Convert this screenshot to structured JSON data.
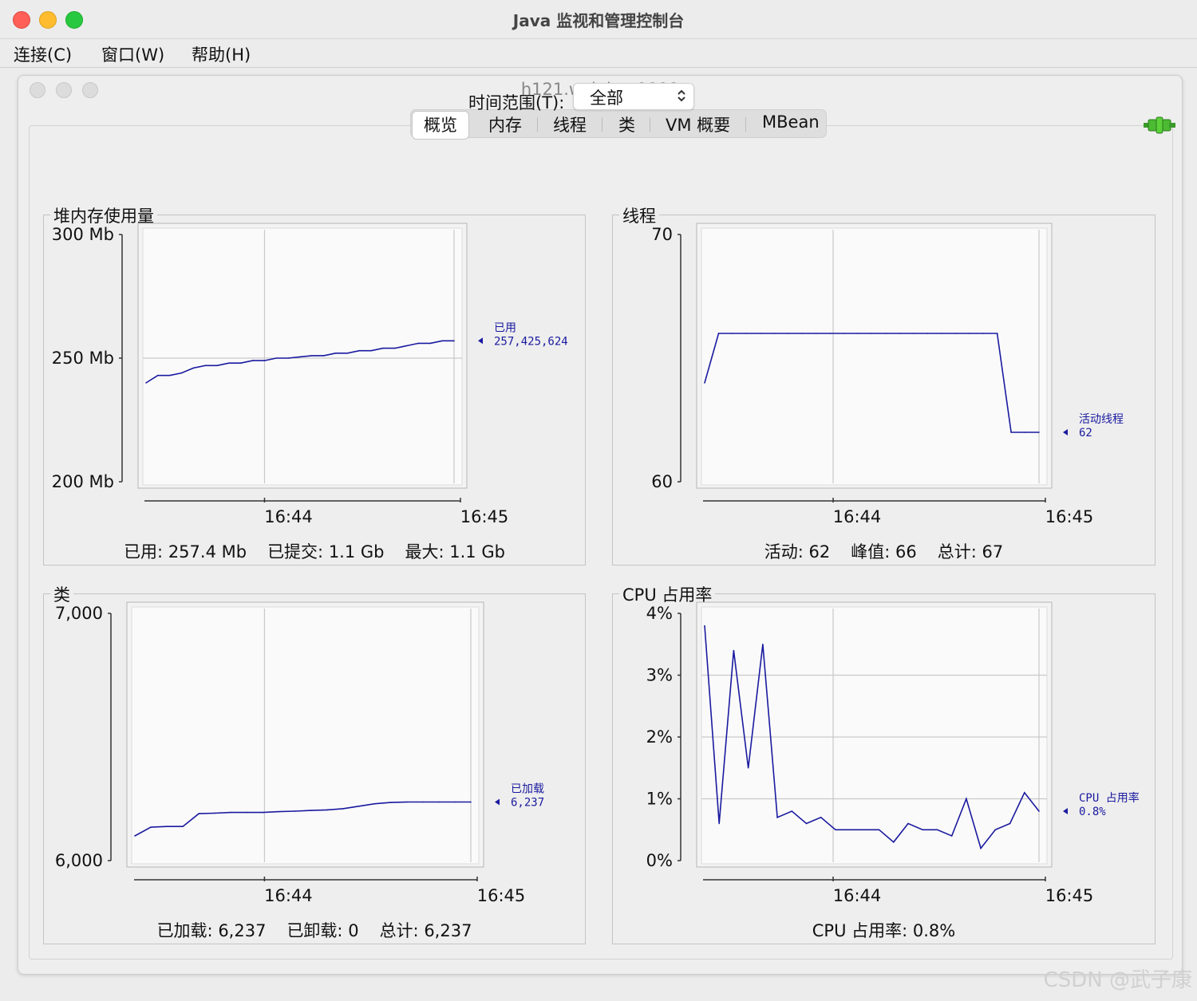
{
  "window": {
    "title": "Java 监视和管理控制台"
  },
  "menu": [
    "连接(C)",
    "窗口(W)",
    "帮助(H)"
  ],
  "connection": {
    "title": "h121.wzk.icu:9999"
  },
  "tabs": [
    {
      "label": "概览",
      "active": true
    },
    {
      "label": "内存"
    },
    {
      "label": "线程"
    },
    {
      "label": "类"
    },
    {
      "label": "VM 概要"
    },
    {
      "label": "MBean"
    }
  ],
  "time_range": {
    "label": "时间范围(T):",
    "value": "全部"
  },
  "x_ticks": [
    "16:44",
    "16:45"
  ],
  "colors": {
    "line": "#1a1aa0",
    "grid": "#c9c9c9"
  },
  "chart_data": [
    {
      "type": "line",
      "title": "堆内存使用量",
      "y_ticks": [
        "300 Mb",
        "250 Mb",
        "200 Mb"
      ],
      "ylim": [
        200,
        300
      ],
      "y": [
        240,
        243,
        243,
        244,
        246,
        247,
        247,
        248,
        248,
        249,
        249,
        250,
        250,
        250.5,
        251,
        251,
        252,
        252,
        253,
        253,
        254,
        254,
        255,
        256,
        256,
        257,
        257
      ],
      "legend": {
        "name": "已用",
        "value": "257,425,624"
      },
      "summary": [
        "已用: 257.4 Mb",
        "已提交: 1.1 Gb",
        "最大: 1.1 Gb"
      ]
    },
    {
      "type": "line",
      "title": "线程",
      "y_ticks": [
        "70",
        "60"
      ],
      "ylim": [
        60,
        70
      ],
      "y": [
        64,
        66,
        66,
        66,
        66,
        66,
        66,
        66,
        66,
        66,
        66,
        66,
        66,
        66,
        66,
        66,
        66,
        66,
        66,
        66,
        66,
        66,
        62,
        62,
        62
      ],
      "legend": {
        "name": "活动线程",
        "value": "62"
      },
      "summary": [
        "活动: 62",
        "峰值: 66",
        "总计: 67"
      ]
    },
    {
      "type": "line",
      "title": "类",
      "y_ticks": [
        "7,000",
        "6,000"
      ],
      "ylim": [
        6000,
        7000
      ],
      "y": [
        6100,
        6135,
        6138,
        6138,
        6190,
        6192,
        6195,
        6195,
        6195,
        6198,
        6200,
        6203,
        6205,
        6210,
        6220,
        6230,
        6235,
        6237,
        6237,
        6237,
        6237,
        6237
      ],
      "legend": {
        "name": "已加载",
        "value": "6,237"
      },
      "summary": [
        "已加载: 6,237",
        "已卸载: 0",
        "总计: 6,237"
      ]
    },
    {
      "type": "line",
      "title": "CPU 占用率",
      "y_ticks": [
        "4%",
        "3%",
        "2%",
        "1%",
        "0%"
      ],
      "ylim": [
        0,
        4
      ],
      "y": [
        3.8,
        0.6,
        3.4,
        1.5,
        3.5,
        0.7,
        0.8,
        0.6,
        0.7,
        0.5,
        0.5,
        0.5,
        0.5,
        0.3,
        0.6,
        0.5,
        0.5,
        0.4,
        1.0,
        0.2,
        0.5,
        0.6,
        1.1,
        0.8
      ],
      "legend": {
        "name": "CPU 占用率",
        "value": "0.8%"
      },
      "summary": [
        "CPU 占用率: 0.8%"
      ]
    }
  ],
  "watermark": "CSDN @武子康"
}
